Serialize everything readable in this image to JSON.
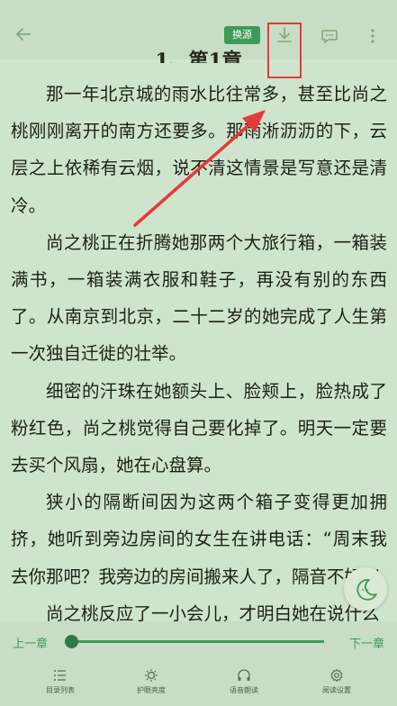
{
  "header": {
    "source_label": "换源"
  },
  "chapter": {
    "title": "1、第1章"
  },
  "paragraphs": [
    "那一年北京城的雨水比往常多，甚至比尚之桃刚刚离开的南方还要多。那雨淅沥沥的下，云层之上依稀有云烟，说不清这情景是写意还是清冷。",
    "尚之桃正在折腾她那两个大旅行箱，一箱装满书，一箱装满衣服和鞋子，再没有别的东西了。从南京到北京，二十二岁的她完成了人生第一次独自迁徙的壮举。",
    "细密的汗珠在她额头上、脸颊上，脸热成了粉红色，尚之桃觉得自己要化掉了。明天一定要去买个风扇，她在心盘算。",
    "狭小的隔断间因为这两个箱子变得更加拥挤，她听到旁边房间的女生在讲电话：“周末我去你那吧？我旁边的房间搬来人了，隔音不好。”",
    "尚之桃反应了一小会儿，才明白她在说什么"
  ],
  "progress": {
    "prev_label": "上一章",
    "next_label": "下一章",
    "value": 0.0
  },
  "bottom_nav": [
    {
      "label": "目录列表",
      "icon": "list-icon"
    },
    {
      "label": "护眼亮度",
      "icon": "brightness-icon"
    },
    {
      "label": "语音朗读",
      "icon": "headphones-icon"
    },
    {
      "label": "阅读设置",
      "icon": "gear-icon"
    }
  ],
  "colors": {
    "background": "#cfe4cc",
    "accent": "#3f9a5a",
    "annotation": "#e53a3a"
  }
}
